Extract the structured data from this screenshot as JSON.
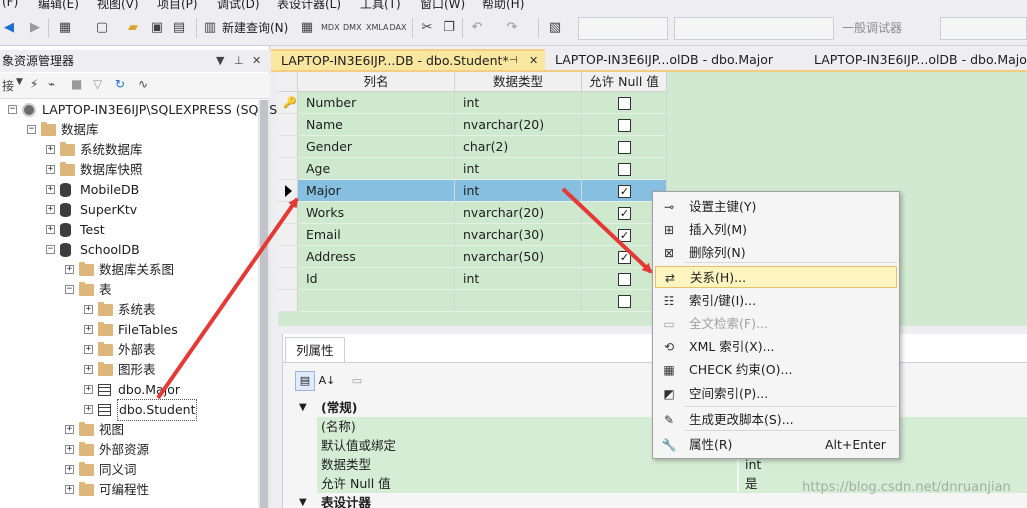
{
  "menubar": {
    "items": [
      "(F)",
      "编辑(E)",
      "视图(V)",
      "项目(P)",
      "调试(D)",
      "表设计器(L)",
      "工具(T)",
      "窗口(W)",
      "帮助(H)"
    ]
  },
  "toolbar": {
    "new_query": "新建查询(N)",
    "debugger": "一般调试器"
  },
  "explorer": {
    "title": "象资源管理器",
    "connect": "接",
    "tree": [
      {
        "label": "LAPTOP-IN3E6IJP\\SQLEXPRESS (SQL Se",
        "kind": "server",
        "expander": "-"
      },
      {
        "label": "数据库",
        "kind": "folder",
        "expander": "-"
      },
      {
        "label": "系统数据库",
        "kind": "folder",
        "expander": "+"
      },
      {
        "label": "数据库快照",
        "kind": "folder",
        "expander": "+"
      },
      {
        "label": "MobileDB",
        "kind": "db",
        "expander": "+"
      },
      {
        "label": "SuperKtv",
        "kind": "db",
        "expander": "+"
      },
      {
        "label": "Test",
        "kind": "db",
        "expander": "+"
      },
      {
        "label": "SchoolDB",
        "kind": "db",
        "expander": "-"
      },
      {
        "label": "数据库关系图",
        "kind": "folder",
        "expander": "+"
      },
      {
        "label": "表",
        "kind": "folder",
        "expander": "-"
      },
      {
        "label": "系统表",
        "kind": "folder",
        "expander": "+"
      },
      {
        "label": "FileTables",
        "kind": "folder",
        "expander": "+"
      },
      {
        "label": "外部表",
        "kind": "folder",
        "expander": "+"
      },
      {
        "label": "图形表",
        "kind": "folder",
        "expander": "+"
      },
      {
        "label": "dbo.Major",
        "kind": "table",
        "expander": "+"
      },
      {
        "label": "dbo.Student",
        "kind": "table",
        "expander": "+"
      },
      {
        "label": "视图",
        "kind": "folder",
        "expander": "+"
      },
      {
        "label": "外部资源",
        "kind": "folder",
        "expander": "+"
      },
      {
        "label": "同义词",
        "kind": "folder",
        "expander": "+"
      },
      {
        "label": "可编程性",
        "kind": "folder",
        "expander": "+"
      }
    ]
  },
  "tabs": [
    {
      "label": "LAPTOP-IN3E6IJP...DB - dbo.Student*",
      "active": true
    },
    {
      "label": "LAPTOP-IN3E6IJP...olDB - dbo.Major",
      "active": false
    },
    {
      "label": "LAPTOP-IN3E6IJP...olDB - dbo.Major",
      "active": false
    }
  ],
  "designer": {
    "headers": [
      "列名",
      "数据类型",
      "允许 Null 值"
    ],
    "rows": [
      {
        "name": "Number",
        "type": "int",
        "nullable": false,
        "pk": true
      },
      {
        "name": "Name",
        "type": "nvarchar(20)",
        "nullable": false
      },
      {
        "name": "Gender",
        "type": "char(2)",
        "nullable": false
      },
      {
        "name": "Age",
        "type": "int",
        "nullable": false
      },
      {
        "name": "Major",
        "type": "int",
        "nullable": true,
        "selected": true
      },
      {
        "name": "Works",
        "type": "nvarchar(20)",
        "nullable": true
      },
      {
        "name": "Email",
        "type": "nvarchar(30)",
        "nullable": true
      },
      {
        "name": "Address",
        "type": "nvarchar(50)",
        "nullable": true
      },
      {
        "name": "Id",
        "type": "int",
        "nullable": false
      },
      {
        "name": "",
        "type": "",
        "nullable": false
      }
    ]
  },
  "properties": {
    "tab": "列属性",
    "category_general": "(常规)",
    "rows": [
      {
        "k": "(名称)",
        "v": ""
      },
      {
        "k": "默认值或绑定",
        "v": ""
      },
      {
        "k": "数据类型",
        "v": "int"
      },
      {
        "k": "允许 Null 值",
        "v": "是"
      }
    ],
    "category_designer": "表设计器"
  },
  "context_menu": {
    "items": [
      {
        "label": "设置主键(Y)",
        "icon": "key-icon"
      },
      {
        "label": "插入列(M)",
        "icon": "insert-column-icon"
      },
      {
        "label": "删除列(N)",
        "icon": "delete-column-icon"
      },
      {
        "label": "关系(H)...",
        "icon": "relationship-icon",
        "highlight": true
      },
      {
        "label": "索引/键(I)...",
        "icon": "index-icon"
      },
      {
        "label": "全文检索(F)...",
        "icon": "fulltext-icon",
        "disabled": true
      },
      {
        "label": "XML 索引(X)...",
        "icon": "xml-index-icon"
      },
      {
        "label": "CHECK 约束(O)...",
        "icon": "check-constraint-icon"
      },
      {
        "label": "空间索引(P)...",
        "icon": "spatial-index-icon"
      },
      {
        "label": "生成更改脚本(S)...",
        "icon": "script-icon"
      },
      {
        "label": "属性(R)",
        "icon": "wrench-icon",
        "shortcut": "Alt+Enter"
      }
    ]
  },
  "watermark": "https://blog.csdn.net/dnruanjian",
  "colors": {
    "green_cell": "#cfe9cf",
    "selected_row": "#86bfe0",
    "active_tab": "#f9e79f",
    "menu_highlight": "#fdf4bf",
    "arrow": "#e53935"
  }
}
